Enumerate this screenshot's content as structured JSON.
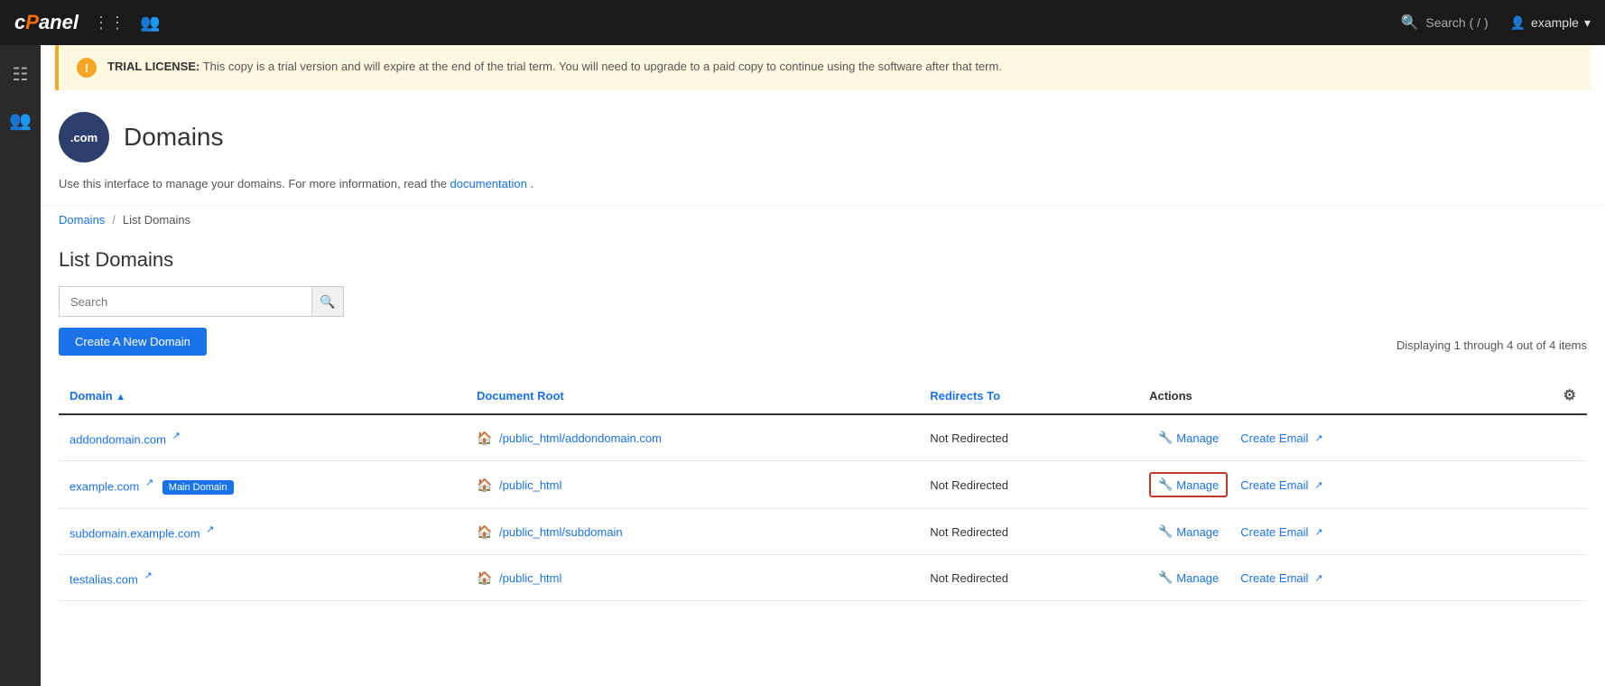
{
  "topnav": {
    "logo": "cPanel",
    "search_label": "Search ( / )",
    "user_label": "example",
    "caret": "▾"
  },
  "sidebar": {
    "grid_icon": "⊞",
    "users_icon": "👥"
  },
  "trial_banner": {
    "icon": "!",
    "bold_label": "TRIAL LICENSE:",
    "message": " This copy is a trial version and will expire at the end of the trial term. You will need to upgrade to a paid copy to continue using the software after that term."
  },
  "page": {
    "icon_text": ".com",
    "title": "Domains",
    "description": "Use this interface to manage your domains. For more information, read the ",
    "doc_link_text": "documentation",
    "doc_link_suffix": "."
  },
  "breadcrumb": {
    "parent": "Domains",
    "separator": "/",
    "current": "List Domains"
  },
  "list_domains": {
    "title": "List Domains",
    "search_placeholder": "Search",
    "create_button": "Create A New Domain",
    "display_count": "Displaying 1 through 4 out of 4 items",
    "table": {
      "headers": {
        "domain": "Domain",
        "sort_arrow": "▲",
        "document_root": "Document Root",
        "redirects_to": "Redirects To",
        "actions": "Actions"
      },
      "rows": [
        {
          "domain": "addondomain.com",
          "main_domain": false,
          "doc_root": "/public_html/addondomain.com",
          "redirects_to": "Not Redirected",
          "manage_label": "Manage",
          "create_email_label": "Create Email",
          "highlighted": false
        },
        {
          "domain": "example.com",
          "main_domain": true,
          "main_domain_label": "Main Domain",
          "doc_root": "/public_html",
          "redirects_to": "Not Redirected",
          "manage_label": "Manage",
          "create_email_label": "Create Email",
          "highlighted": true
        },
        {
          "domain": "subdomain.example.com",
          "main_domain": false,
          "doc_root": "/public_html/subdomain",
          "redirects_to": "Not Redirected",
          "manage_label": "Manage",
          "create_email_label": "Create Email",
          "highlighted": false
        },
        {
          "domain": "testalias.com",
          "main_domain": false,
          "doc_root": "/public_html",
          "redirects_to": "Not Redirected",
          "manage_label": "Manage",
          "create_email_label": "Create Email",
          "highlighted": false
        }
      ]
    }
  }
}
